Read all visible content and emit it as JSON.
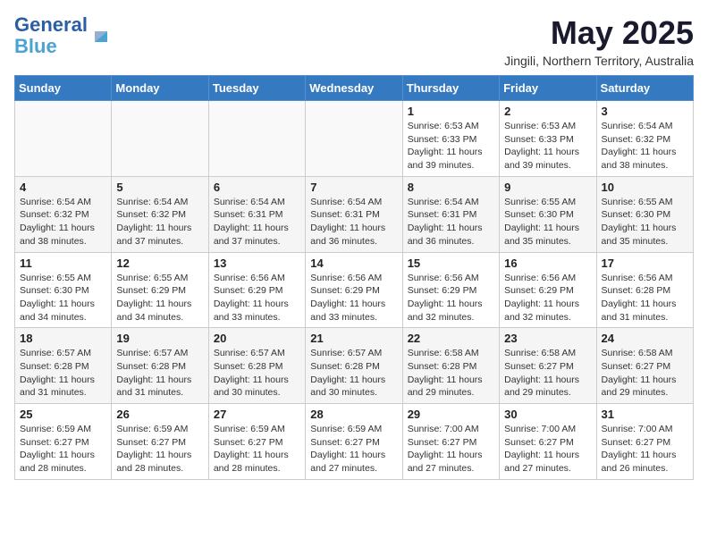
{
  "logo": {
    "line1": "General",
    "line2": "Blue"
  },
  "title": "May 2025",
  "location": "Jingili, Northern Territory, Australia",
  "days_of_week": [
    "Sunday",
    "Monday",
    "Tuesday",
    "Wednesday",
    "Thursday",
    "Friday",
    "Saturday"
  ],
  "weeks": [
    [
      {
        "day": "",
        "info": ""
      },
      {
        "day": "",
        "info": ""
      },
      {
        "day": "",
        "info": ""
      },
      {
        "day": "",
        "info": ""
      },
      {
        "day": "1",
        "info": "Sunrise: 6:53 AM\nSunset: 6:33 PM\nDaylight: 11 hours and 39 minutes."
      },
      {
        "day": "2",
        "info": "Sunrise: 6:53 AM\nSunset: 6:33 PM\nDaylight: 11 hours and 39 minutes."
      },
      {
        "day": "3",
        "info": "Sunrise: 6:54 AM\nSunset: 6:32 PM\nDaylight: 11 hours and 38 minutes."
      }
    ],
    [
      {
        "day": "4",
        "info": "Sunrise: 6:54 AM\nSunset: 6:32 PM\nDaylight: 11 hours and 38 minutes."
      },
      {
        "day": "5",
        "info": "Sunrise: 6:54 AM\nSunset: 6:32 PM\nDaylight: 11 hours and 37 minutes."
      },
      {
        "day": "6",
        "info": "Sunrise: 6:54 AM\nSunset: 6:31 PM\nDaylight: 11 hours and 37 minutes."
      },
      {
        "day": "7",
        "info": "Sunrise: 6:54 AM\nSunset: 6:31 PM\nDaylight: 11 hours and 36 minutes."
      },
      {
        "day": "8",
        "info": "Sunrise: 6:54 AM\nSunset: 6:31 PM\nDaylight: 11 hours and 36 minutes."
      },
      {
        "day": "9",
        "info": "Sunrise: 6:55 AM\nSunset: 6:30 PM\nDaylight: 11 hours and 35 minutes."
      },
      {
        "day": "10",
        "info": "Sunrise: 6:55 AM\nSunset: 6:30 PM\nDaylight: 11 hours and 35 minutes."
      }
    ],
    [
      {
        "day": "11",
        "info": "Sunrise: 6:55 AM\nSunset: 6:30 PM\nDaylight: 11 hours and 34 minutes."
      },
      {
        "day": "12",
        "info": "Sunrise: 6:55 AM\nSunset: 6:29 PM\nDaylight: 11 hours and 34 minutes."
      },
      {
        "day": "13",
        "info": "Sunrise: 6:56 AM\nSunset: 6:29 PM\nDaylight: 11 hours and 33 minutes."
      },
      {
        "day": "14",
        "info": "Sunrise: 6:56 AM\nSunset: 6:29 PM\nDaylight: 11 hours and 33 minutes."
      },
      {
        "day": "15",
        "info": "Sunrise: 6:56 AM\nSunset: 6:29 PM\nDaylight: 11 hours and 32 minutes."
      },
      {
        "day": "16",
        "info": "Sunrise: 6:56 AM\nSunset: 6:29 PM\nDaylight: 11 hours and 32 minutes."
      },
      {
        "day": "17",
        "info": "Sunrise: 6:56 AM\nSunset: 6:28 PM\nDaylight: 11 hours and 31 minutes."
      }
    ],
    [
      {
        "day": "18",
        "info": "Sunrise: 6:57 AM\nSunset: 6:28 PM\nDaylight: 11 hours and 31 minutes."
      },
      {
        "day": "19",
        "info": "Sunrise: 6:57 AM\nSunset: 6:28 PM\nDaylight: 11 hours and 31 minutes."
      },
      {
        "day": "20",
        "info": "Sunrise: 6:57 AM\nSunset: 6:28 PM\nDaylight: 11 hours and 30 minutes."
      },
      {
        "day": "21",
        "info": "Sunrise: 6:57 AM\nSunset: 6:28 PM\nDaylight: 11 hours and 30 minutes."
      },
      {
        "day": "22",
        "info": "Sunrise: 6:58 AM\nSunset: 6:28 PM\nDaylight: 11 hours and 29 minutes."
      },
      {
        "day": "23",
        "info": "Sunrise: 6:58 AM\nSunset: 6:27 PM\nDaylight: 11 hours and 29 minutes."
      },
      {
        "day": "24",
        "info": "Sunrise: 6:58 AM\nSunset: 6:27 PM\nDaylight: 11 hours and 29 minutes."
      }
    ],
    [
      {
        "day": "25",
        "info": "Sunrise: 6:59 AM\nSunset: 6:27 PM\nDaylight: 11 hours and 28 minutes."
      },
      {
        "day": "26",
        "info": "Sunrise: 6:59 AM\nSunset: 6:27 PM\nDaylight: 11 hours and 28 minutes."
      },
      {
        "day": "27",
        "info": "Sunrise: 6:59 AM\nSunset: 6:27 PM\nDaylight: 11 hours and 28 minutes."
      },
      {
        "day": "28",
        "info": "Sunrise: 6:59 AM\nSunset: 6:27 PM\nDaylight: 11 hours and 27 minutes."
      },
      {
        "day": "29",
        "info": "Sunrise: 7:00 AM\nSunset: 6:27 PM\nDaylight: 11 hours and 27 minutes."
      },
      {
        "day": "30",
        "info": "Sunrise: 7:00 AM\nSunset: 6:27 PM\nDaylight: 11 hours and 27 minutes."
      },
      {
        "day": "31",
        "info": "Sunrise: 7:00 AM\nSunset: 6:27 PM\nDaylight: 11 hours and 26 minutes."
      }
    ]
  ]
}
